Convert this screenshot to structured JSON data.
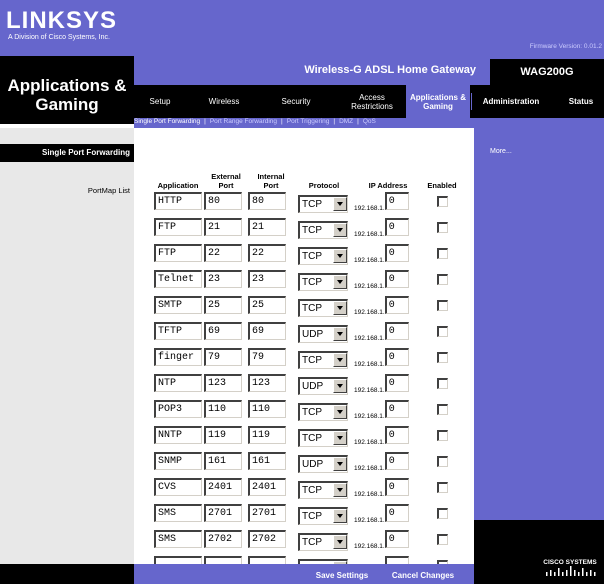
{
  "brand": {
    "logo_text": "LINKSYS",
    "tagline": "A Division of Cisco Systems, Inc.",
    "firmware": "Firmware Version: 0.01.2"
  },
  "page_title": "Applications & Gaming",
  "product": {
    "name": "Wireless-G ADSL Home Gateway",
    "model": "WAG200G"
  },
  "tabs": [
    {
      "label": "Setup",
      "active": false
    },
    {
      "label": "Wireless",
      "active": false
    },
    {
      "label": "Security",
      "active": false
    },
    {
      "label": "Access Restrictions",
      "active": false
    },
    {
      "label": "Applications & Gaming",
      "active": true
    },
    {
      "label": "Administration",
      "active": false
    },
    {
      "label": "Status",
      "active": false
    }
  ],
  "subtabs": [
    {
      "label": "Single Port Forwarding",
      "active": true
    },
    {
      "label": "Port Range Forwarding",
      "active": false
    },
    {
      "label": "Port Triggering",
      "active": false
    },
    {
      "label": "DMZ",
      "active": false
    },
    {
      "label": "QoS",
      "active": false
    }
  ],
  "sidebar": {
    "section_title": "Single Port Forwarding",
    "portmap_label": "PortMap List"
  },
  "right_col": {
    "more_link": "More..."
  },
  "table": {
    "headers": {
      "application": "Application",
      "external_port": "External Port",
      "internal_port": "Internal Port",
      "protocol": "Protocol",
      "ip_address": "IP Address",
      "enabled": "Enabled"
    },
    "ip_prefix": "192.168.1.",
    "rows": [
      {
        "app": "HTTP",
        "ext": "80",
        "int": "80",
        "proto": "TCP",
        "ip": "0",
        "enabled": false
      },
      {
        "app": "FTP",
        "ext": "21",
        "int": "21",
        "proto": "TCP",
        "ip": "0",
        "enabled": false
      },
      {
        "app": "FTP",
        "ext": "22",
        "int": "22",
        "proto": "TCP",
        "ip": "0",
        "enabled": false
      },
      {
        "app": "Telnet",
        "ext": "23",
        "int": "23",
        "proto": "TCP",
        "ip": "0",
        "enabled": false
      },
      {
        "app": "SMTP",
        "ext": "25",
        "int": "25",
        "proto": "TCP",
        "ip": "0",
        "enabled": false
      },
      {
        "app": "TFTP",
        "ext": "69",
        "int": "69",
        "proto": "UDP",
        "ip": "0",
        "enabled": false
      },
      {
        "app": "finger",
        "ext": "79",
        "int": "79",
        "proto": "TCP",
        "ip": "0",
        "enabled": false
      },
      {
        "app": "NTP",
        "ext": "123",
        "int": "123",
        "proto": "UDP",
        "ip": "0",
        "enabled": false
      },
      {
        "app": "POP3",
        "ext": "110",
        "int": "110",
        "proto": "TCP",
        "ip": "0",
        "enabled": false
      },
      {
        "app": "NNTP",
        "ext": "119",
        "int": "119",
        "proto": "TCP",
        "ip": "0",
        "enabled": false
      },
      {
        "app": "SNMP",
        "ext": "161",
        "int": "161",
        "proto": "UDP",
        "ip": "0",
        "enabled": false
      },
      {
        "app": "CVS",
        "ext": "2401",
        "int": "2401",
        "proto": "TCP",
        "ip": "0",
        "enabled": false
      },
      {
        "app": "SMS",
        "ext": "2701",
        "int": "2701",
        "proto": "TCP",
        "ip": "0",
        "enabled": false
      },
      {
        "app": "SMS",
        "ext": "2702",
        "int": "2702",
        "proto": "TCP",
        "ip": "0",
        "enabled": false
      },
      {
        "app": "",
        "ext": "",
        "int": "",
        "proto": "TCP",
        "ip": "",
        "enabled": false
      }
    ]
  },
  "buttons": {
    "save": "Save Settings",
    "cancel": "Cancel Changes"
  },
  "colors": {
    "purple": "#6666cc",
    "black": "#000000",
    "sidebar_gray": "#e8e8e8"
  },
  "cisco_logo": "CISCO SYSTEMS"
}
